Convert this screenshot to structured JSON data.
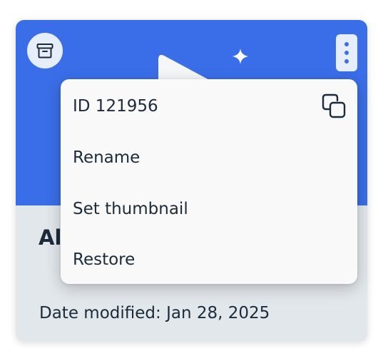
{
  "card": {
    "title": "Al",
    "date_modified_label": "Date modified:",
    "date_modified_value": "Jan 28, 2025",
    "archive_icon": "archive-icon",
    "more_icon": "more-vertical-icon",
    "thumbnail_color": "#3a6ee8"
  },
  "menu": {
    "id_item": {
      "label": "ID 121956",
      "action_icon": "copy-icon"
    },
    "items": [
      {
        "label": "Rename"
      },
      {
        "label": "Set thumbnail"
      },
      {
        "label": "Restore"
      }
    ]
  }
}
